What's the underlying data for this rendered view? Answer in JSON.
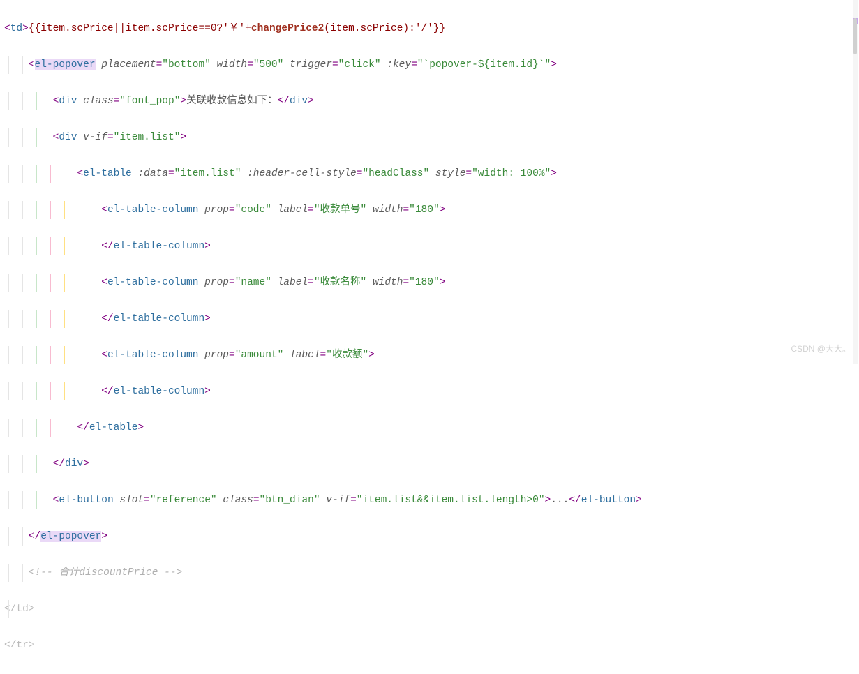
{
  "lines": {
    "l1": "<td>{{item.scPrice||item.scPrice==0?'￥'+changePrice2(item.scPrice):'/'}}",
    "l2": "<el-popover placement=\"bottom\" width=\"500\" trigger=\"click\" :key=\"`popover-${item.id}`\">",
    "l3": "<div class=\"font_pop\">关联收款信息如下：</div>",
    "l4": "<div v-if=\"item.list\">",
    "l5": "<el-table :data=\"item.list\" :header-cell-style=\"headClass\" style=\"width: 100%\">",
    "l6": "<el-table-column prop=\"code\" label=\"收款单号\" width=\"180\">",
    "l7": "</el-table-column>",
    "l8": "<el-table-column prop=\"name\" label=\"收款名称\" width=\"180\">",
    "l9": "</el-table-column>",
    "l10": "<el-table-column prop=\"amount\" label=\"收款额\">",
    "l11": "</el-table-column>",
    "l12": "</el-table>",
    "l13": "</div>",
    "l14": "<el-button slot=\"reference\" class=\"btn_dian\" v-if=\"item.list&&item.list.length>0\">...</el-button>",
    "l15": "</el-popover>",
    "l16": "<!-- 合计discountPrice -->",
    "l17": "</td>",
    "l18": "</tr>"
  },
  "text": {
    "text_l3": "关联收款信息如下：",
    "button_text": "...",
    "comment": "<!-- 合计discountPrice -->",
    "expr": "{{item.scPrice||item.scPrice==0?'￥'+",
    "expr2": "(item.scPrice):'/'}}",
    "fn": "changePrice2"
  },
  "attrs": {
    "placement": "bottom",
    "width500": "500",
    "trigger": "click",
    "key": "`popover-${item.id}`",
    "class_fontpop": "font_pop",
    "vif_list": "item.list",
    "data": "item.list",
    "headerCellStyle": "headClass",
    "style": "width: 100%",
    "prop_code": "code",
    "label_code": "收款单号",
    "width180": "180",
    "prop_name": "name",
    "label_name": "收款名称",
    "prop_amount": "amount",
    "label_amount": "收款额",
    "slot": "reference",
    "class_btn": "btn_dian",
    "vif_btn": "item.list&&item.list.length>0"
  },
  "watermark": "CSDN @大大。"
}
